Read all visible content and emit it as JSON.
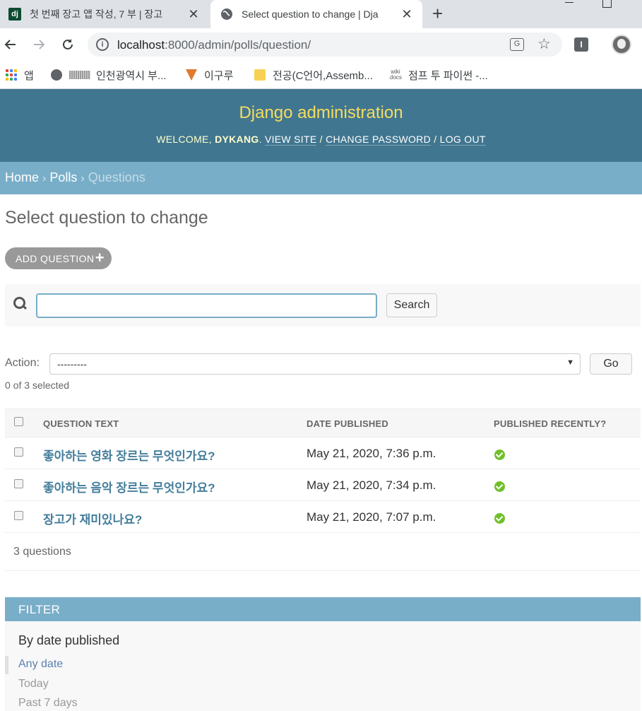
{
  "browser": {
    "tabs": [
      {
        "title": "첫 번째 장고 앱 작성, 7 부 | 장고",
        "close": "✕"
      },
      {
        "title": "Select question to change | Dja",
        "close": "✕"
      }
    ],
    "new_tab": "+",
    "url_host": "localhost",
    "url_path": ":8000/admin/polls/question/",
    "bookmarks": [
      {
        "label": "앱",
        "icon": "apps-grid-icon"
      },
      {
        "label": "인천광역시 부...",
        "icon": "globe-icon"
      },
      {
        "label": "이구루",
        "icon": "pizza-icon"
      },
      {
        "label": "전공(C언어,Assemb...",
        "icon": "folder-icon"
      },
      {
        "label": "점프 투 파이썬 -...",
        "icon": "wikidocs-icon"
      }
    ],
    "extension_label": "I"
  },
  "header": {
    "branding": "Django administration",
    "welcome": "WELCOME,",
    "username": "DYKANG",
    "view_site": "VIEW SITE",
    "change_password": "CHANGE PASSWORD",
    "log_out": "LOG OUT",
    "sep": "/"
  },
  "breadcrumbs": {
    "home": "Home",
    "app": "Polls",
    "current": "Questions",
    "sep": "›"
  },
  "page_title": "Select question to change",
  "add_button": "ADD QUESTION",
  "search": {
    "value": "",
    "button": "Search"
  },
  "actions": {
    "label": "Action:",
    "selected": "---------",
    "go": "Go",
    "selected_count": "0 of 3 selected"
  },
  "table": {
    "headers": [
      "QUESTION TEXT",
      "DATE PUBLISHED",
      "PUBLISHED RECENTLY?"
    ],
    "rows": [
      {
        "question": "좋아하는 영화 장르는 무엇인가요?",
        "date": "May 21, 2020, 7:36 p.m.",
        "recent": true
      },
      {
        "question": "좋아하는 음악 장르는 무엇인가요?",
        "date": "May 21, 2020, 7:34 p.m.",
        "recent": true
      },
      {
        "question": "장고가 재미있나요?",
        "date": "May 21, 2020, 7:07 p.m.",
        "recent": true
      }
    ]
  },
  "paginator": "3 questions",
  "filter": {
    "header": "FILTER",
    "title": "By date published",
    "items": [
      "Any date",
      "Today",
      "Past 7 days"
    ],
    "selected": "Any date"
  },
  "colors": {
    "header_bg": "#417690",
    "breadcrumb_bg": "#79aec8",
    "branding": "#f5dd5d",
    "link": "#447e9b",
    "ok": "#70bf2b"
  }
}
